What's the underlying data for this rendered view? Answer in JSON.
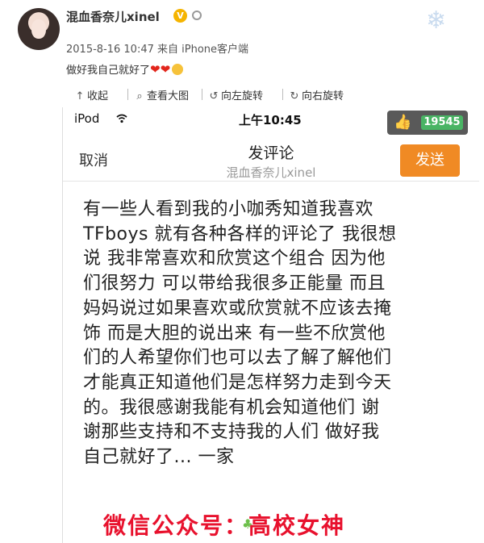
{
  "post": {
    "author": "混血香奈儿xinel",
    "verified_badge": "V",
    "meta_date": "2015-8-16 10:47",
    "meta_source": "来自 iPhone客户端",
    "status_text": "做好我自己就好了",
    "status_emoji": "❤❤"
  },
  "toolbar": {
    "collapse_label": "收起",
    "view_large_label": "查看大图",
    "rotate_left_label": "向左旋转",
    "rotate_right_label": "向右旋转"
  },
  "phone": {
    "carrier": "iPod",
    "time": "上午10:45",
    "cancel_label": "取消",
    "title": "发评论",
    "subtitle": "混血香奈儿xinel",
    "send_label": "发送",
    "like_count": "19545",
    "lines": [
      "有一些人看到我的小咖秀知道我喜欢",
      "TFboys 就有各种各样的评论了 我很想",
      "说 我非常喜欢和欣赏这个组合 因为他",
      "们很努力 可以带给我很多正能量 而且",
      "妈妈说过如果喜欢或欣赏就不应该去掩",
      "饰 而是大胆的说出来 有一些不欣赏他",
      "们的人希望你们也可以去了解了解他们",
      "才能真正知道他们是怎样努力走到今天",
      "的。我很感谢我能有机会知道他们 谢",
      "谢那些支持和不支持我的人们 做好我",
      "自己就好了...  一家"
    ]
  },
  "watermark": "微信公众号：高校女神",
  "colors": {
    "send_button": "#f08a24",
    "watermark": "#e8112d",
    "like_badge": "#2aa84a",
    "verified": "#f5b400"
  }
}
